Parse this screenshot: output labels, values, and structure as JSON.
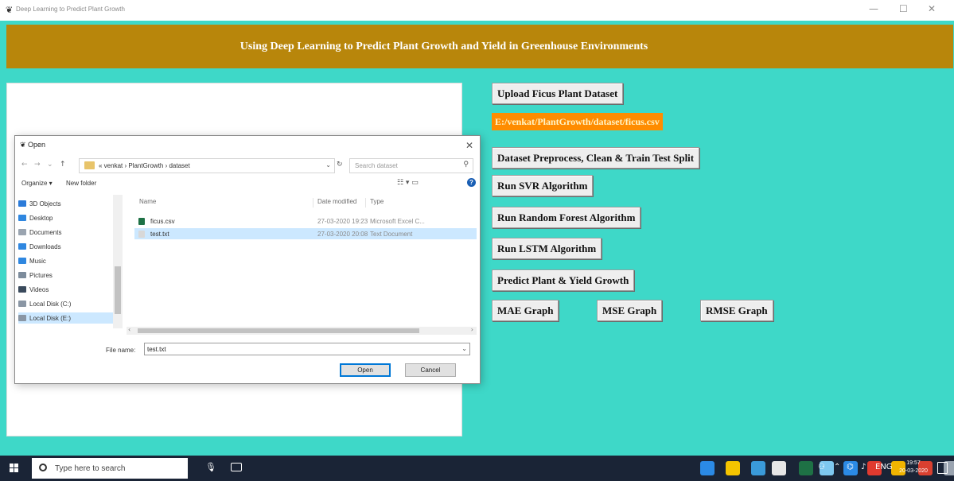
{
  "window": {
    "title": "Deep Learning to Predict Plant Growth",
    "minimize": "—",
    "maximize": "☐",
    "close": "✕"
  },
  "header": {
    "title": "Using Deep Learning to Predict Plant Growth and Yield in Greenhouse Environments"
  },
  "buttons": {
    "upload": "Upload Ficus Plant Dataset",
    "preprocess": "Dataset Preprocess, Clean & Train Test Split",
    "svr": "Run SVR Algorithm",
    "random_forest": "Run Random Forest Algorithm",
    "lstm": "Run LSTM Algorithm",
    "predict": "Predict Plant & Yield Growth",
    "mae": "MAE Graph",
    "mse": "MSE Graph",
    "rmse": "RMSE Graph"
  },
  "dataset_path": "E:/venkat/PlantGrowth/dataset/ficus.csv",
  "dialog": {
    "title": "Open",
    "close": "✕",
    "breadcrumb": "« venkat › PlantGrowth › dataset",
    "search_placeholder": "Search dataset",
    "organize": "Organize ▾",
    "new_folder": "New folder",
    "nav_items": [
      {
        "label": "3D Objects",
        "color": "#2b7bd9"
      },
      {
        "label": "Desktop",
        "color": "#2f87e0"
      },
      {
        "label": "Documents",
        "color": "#9aa4b0"
      },
      {
        "label": "Downloads",
        "color": "#2f87e0"
      },
      {
        "label": "Music",
        "color": "#2f87e0"
      },
      {
        "label": "Pictures",
        "color": "#7d8c9c"
      },
      {
        "label": "Videos",
        "color": "#3a4a5c"
      },
      {
        "label": "Local Disk (C:)",
        "color": "#8a96a4"
      },
      {
        "label": "Local Disk (E:)",
        "color": "#8a96a4"
      }
    ],
    "columns": {
      "name": "Name",
      "date": "Date modified",
      "type": "Type"
    },
    "files": [
      {
        "name": "ficus.csv",
        "date": "27-03-2020 19:23",
        "type": "Microsoft Excel C...",
        "color": "#1e7145"
      },
      {
        "name": "test.txt",
        "date": "27-03-2020 20:08",
        "type": "Text Document",
        "color": "#d8d8d8"
      }
    ],
    "file_name_label": "File name:",
    "file_name_value": "test.txt",
    "open_button": "Open",
    "cancel_button": "Cancel"
  },
  "taskbar": {
    "search_placeholder": "Type here to search",
    "apps": [
      {
        "name": "edge",
        "color": "#2b8ae6"
      },
      {
        "name": "store",
        "color": "#f5c400"
      },
      {
        "name": "explorer",
        "color": "#3a9ad9"
      },
      {
        "name": "app4",
        "color": "#e7e7e7"
      },
      {
        "name": "excel",
        "color": "#1e7145"
      },
      {
        "name": "app6",
        "color": "#7ec8f0"
      },
      {
        "name": "mail",
        "color": "#2b8ae6"
      },
      {
        "name": "acrobat",
        "color": "#e03a2f"
      },
      {
        "name": "chrome",
        "color": "#f0b400"
      },
      {
        "name": "app10",
        "color": "#d94030"
      },
      {
        "name": "app11",
        "color": "#9aa4b0"
      },
      {
        "name": "python",
        "color": "#c8d08a"
      }
    ],
    "time": "19:57",
    "date": "20-03-2020"
  }
}
